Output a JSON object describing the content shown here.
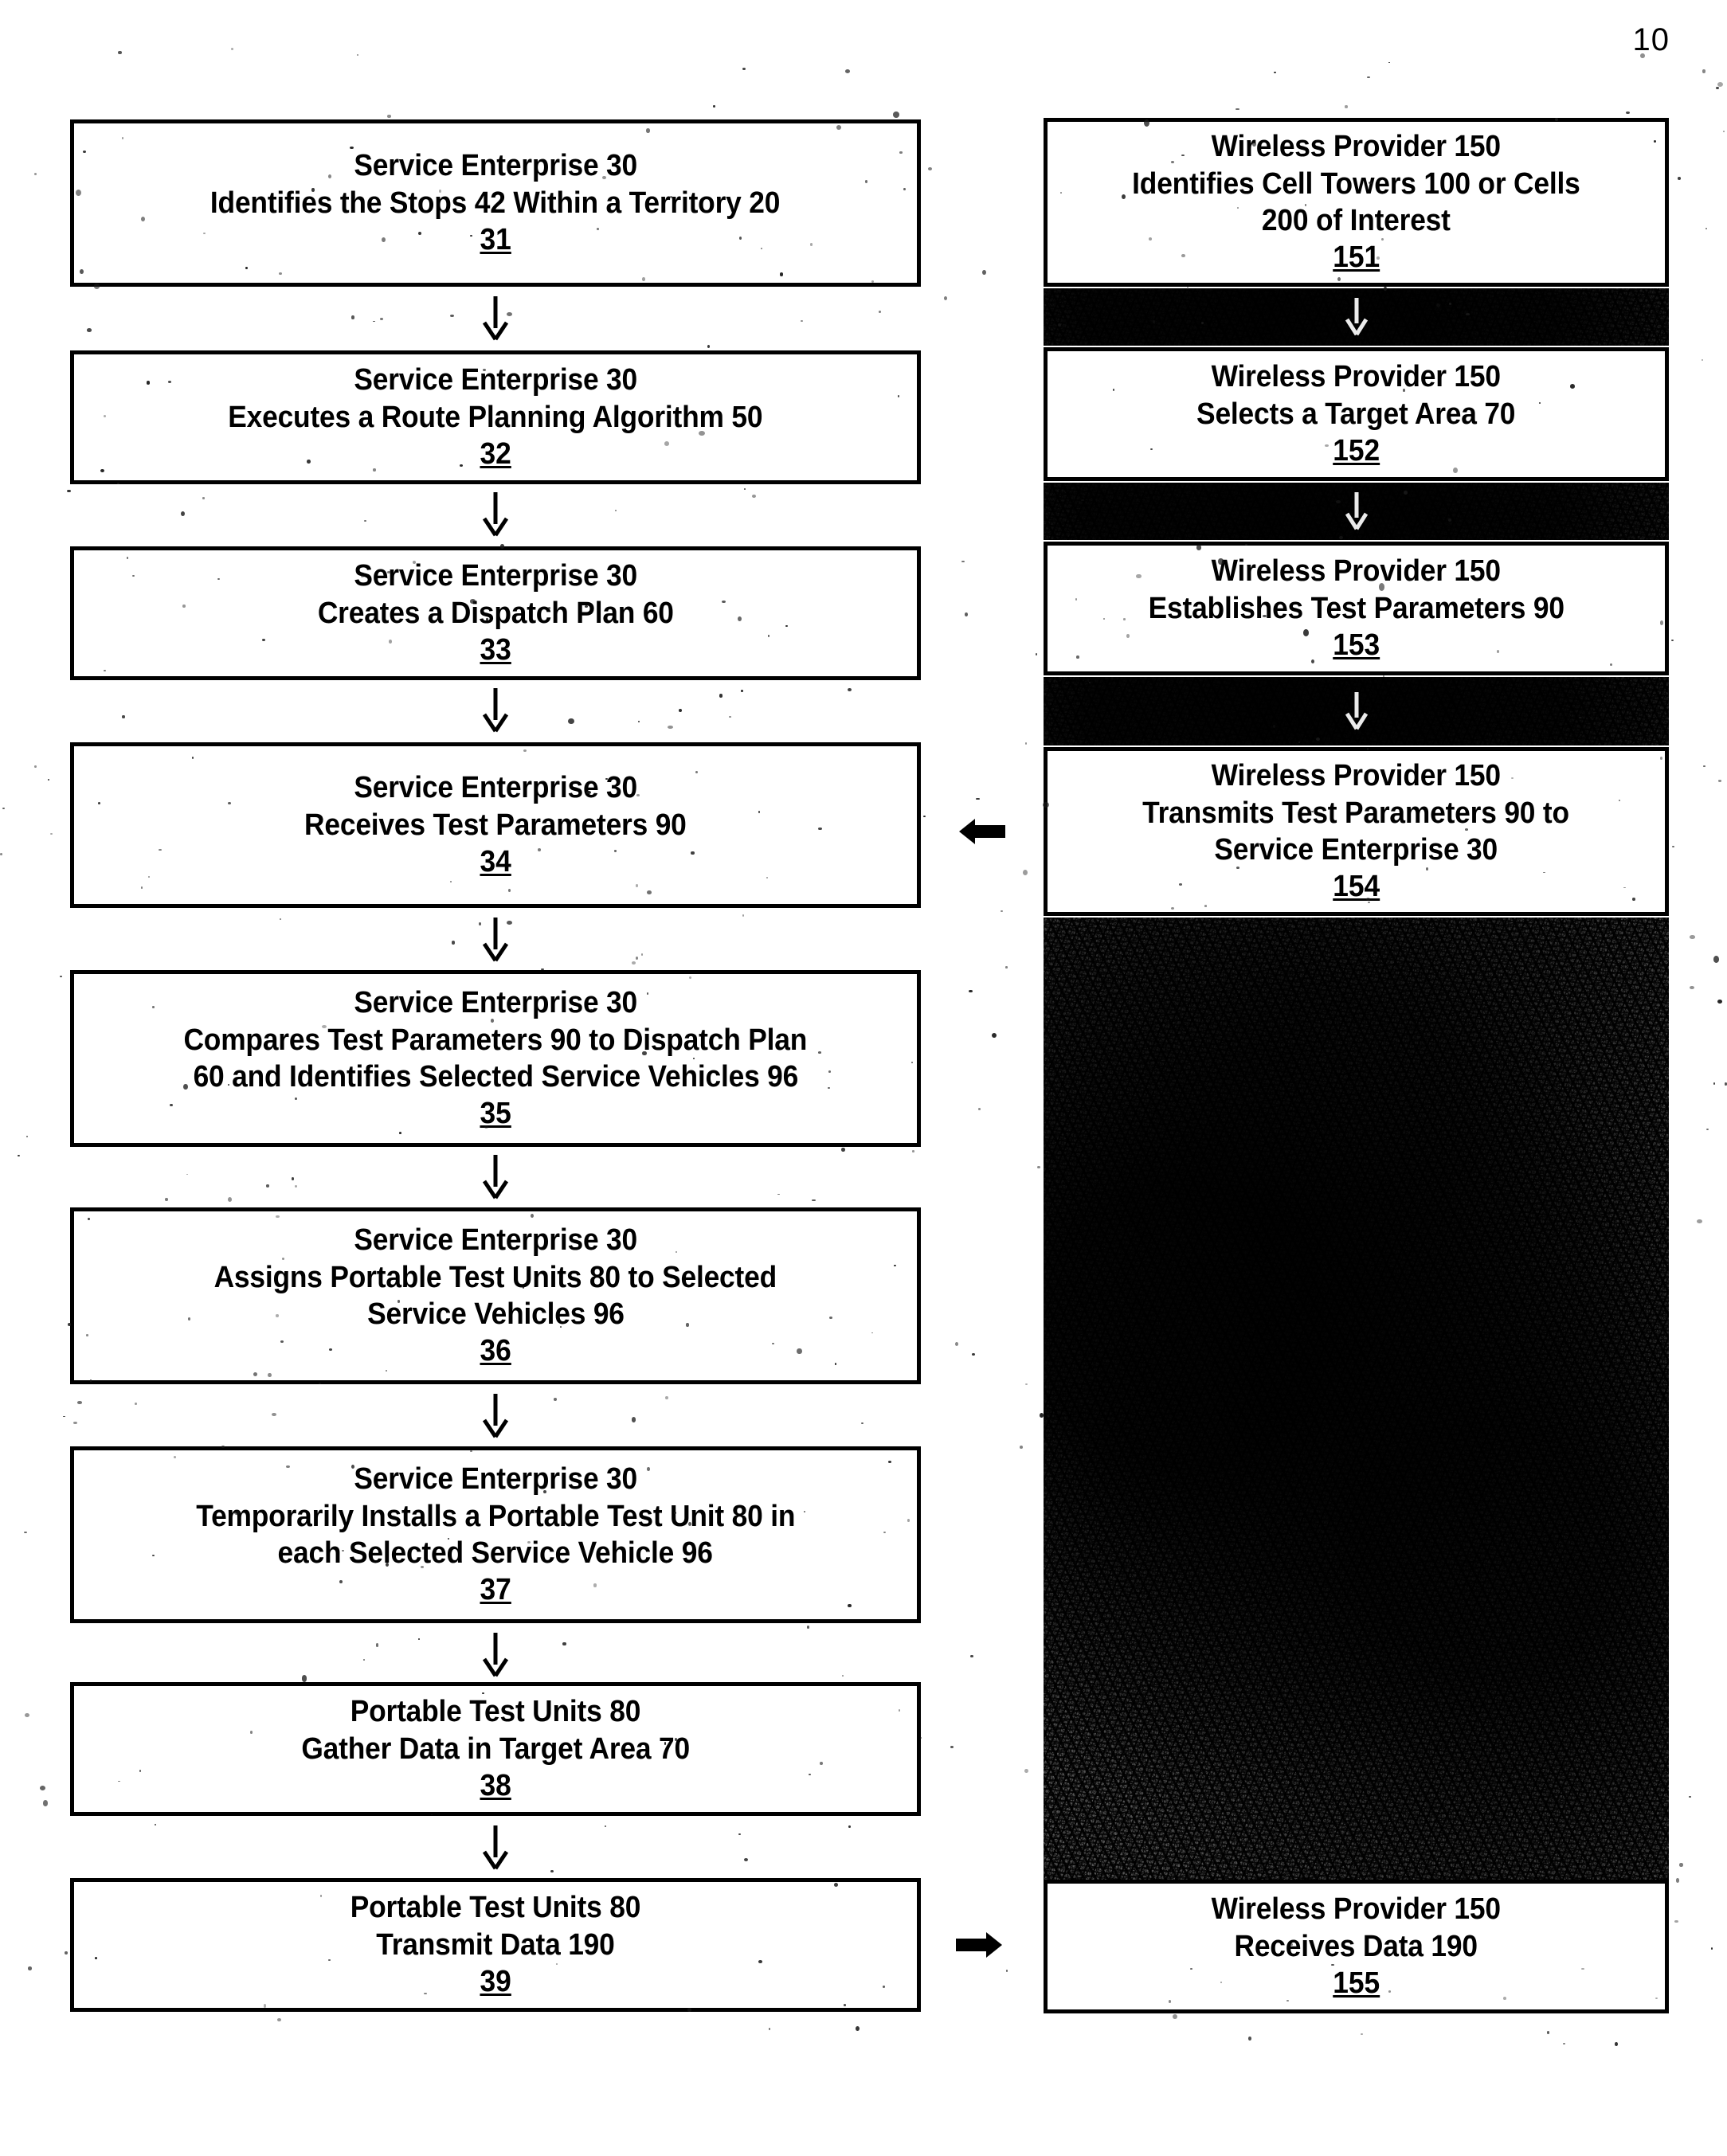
{
  "page": {
    "page_number": "10",
    "figure_type": "patent-flowchart",
    "ink_color": "#000000",
    "paper_color": "#ffffff"
  },
  "left_column": {
    "name": "service-enterprise-flow",
    "boxes": [
      {
        "id": "box-31",
        "lines": [
          "Service Enterprise 30",
          "Identifies the Stops 42 Within a Territory 20"
        ],
        "ref": "31"
      },
      {
        "id": "box-32",
        "lines": [
          "Service Enterprise 30",
          "Executes a Route Planning Algorithm 50"
        ],
        "ref": "32"
      },
      {
        "id": "box-33",
        "lines": [
          "Service Enterprise 30",
          "Creates a Dispatch Plan 60"
        ],
        "ref": "33"
      },
      {
        "id": "box-34",
        "lines": [
          "Service Enterprise 30",
          "Receives Test Parameters 90"
        ],
        "ref": "34"
      },
      {
        "id": "box-35",
        "lines": [
          "Service Enterprise 30",
          "Compares Test Parameters 90 to Dispatch Plan",
          "60 and Identifies Selected Service Vehicles 96"
        ],
        "ref": "35"
      },
      {
        "id": "box-36",
        "lines": [
          "Service Enterprise 30",
          "Assigns Portable Test Units 80 to Selected",
          "Service Vehicles 96"
        ],
        "ref": "36"
      },
      {
        "id": "box-37",
        "lines": [
          "Service Enterprise 30",
          "Temporarily Installs a Portable Test Unit 80 in",
          "each Selected Service Vehicle 96"
        ],
        "ref": "37"
      },
      {
        "id": "box-38",
        "lines": [
          "Portable Test Units 80",
          "Gather Data in Target Area 70"
        ],
        "ref": "38"
      },
      {
        "id": "box-39",
        "lines": [
          "Portable Test Units 80",
          "Transmit Data 190"
        ],
        "ref": "39"
      }
    ]
  },
  "right_column": {
    "name": "wireless-provider-flow",
    "boxes": [
      {
        "id": "box-151",
        "lines": [
          "Wireless Provider 150",
          "Identifies Cell Towers 100 or Cells",
          "200 of Interest"
        ],
        "ref": "151"
      },
      {
        "id": "box-152",
        "lines": [
          "Wireless Provider 150",
          "Selects a Target Area 70"
        ],
        "ref": "152"
      },
      {
        "id": "box-153",
        "lines": [
          "Wireless Provider 150",
          "Establishes Test Parameters 90"
        ],
        "ref": "153"
      },
      {
        "id": "box-154",
        "lines": [
          "Wireless Provider 150",
          "Transmits Test Parameters 90 to",
          "Service Enterprise 30"
        ],
        "ref": "154"
      },
      {
        "id": "box-155",
        "lines": [
          "Wireless Provider 150",
          "Receives Data 190"
        ],
        "ref": "155"
      }
    ]
  },
  "connectors": {
    "left_down_arrow_glyph": "down-arrow",
    "right_down_arrow_glyph": "down-arrow",
    "cross_arrow_to_left": "left-arrow",
    "cross_arrow_to_right": "right-arrow"
  }
}
